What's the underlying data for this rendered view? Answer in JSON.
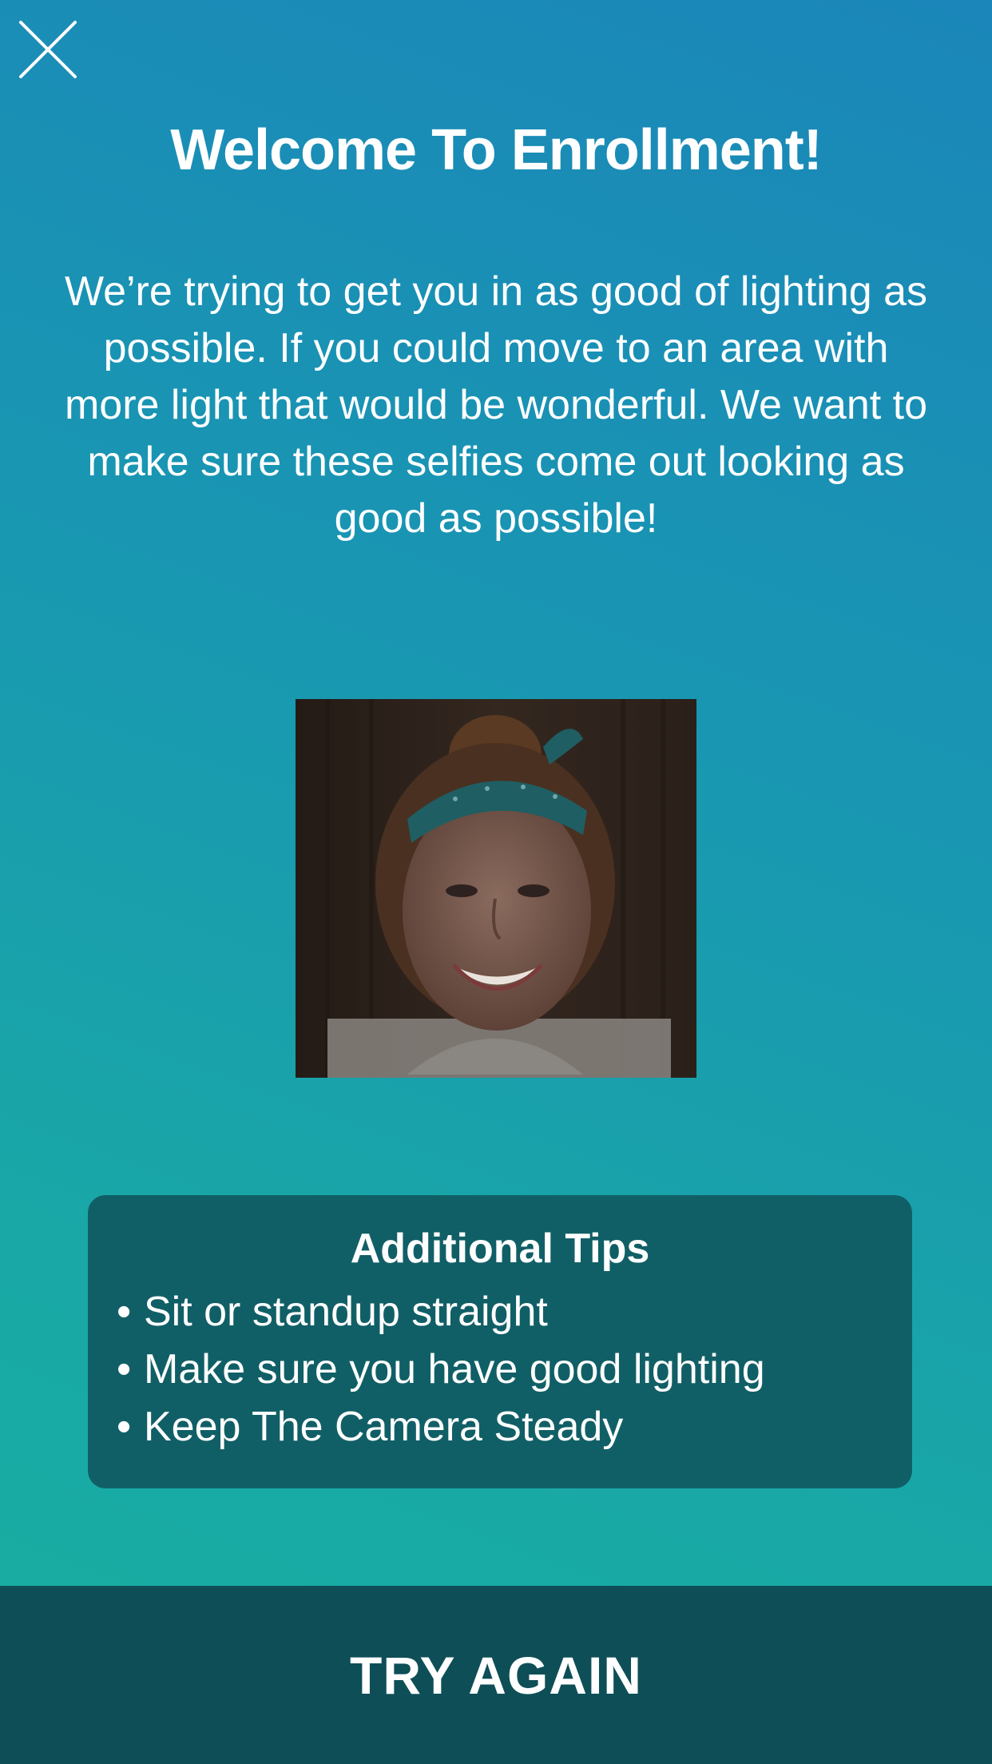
{
  "header": {
    "close_icon": "close-icon"
  },
  "title": "Welcome To Enrollment!",
  "message": "We’re trying to get you in as good of lighting as possible.  If you could move to an area with more light that would be wonderful. We want to make sure these selfies come out looking as good as possible!",
  "tips": {
    "title": "Additional Tips",
    "bullet": "•",
    "items": [
      "Sit or standup straight",
      "Make sure you have good lighting",
      "Keep The Camera Steady"
    ]
  },
  "action": {
    "label": "TRY AGAIN"
  },
  "colors": {
    "gradient_top": "#1a86b9",
    "gradient_bottom": "#17aea0",
    "card": "#115f66",
    "footer": "#0e4e57",
    "text": "#ffffff"
  }
}
